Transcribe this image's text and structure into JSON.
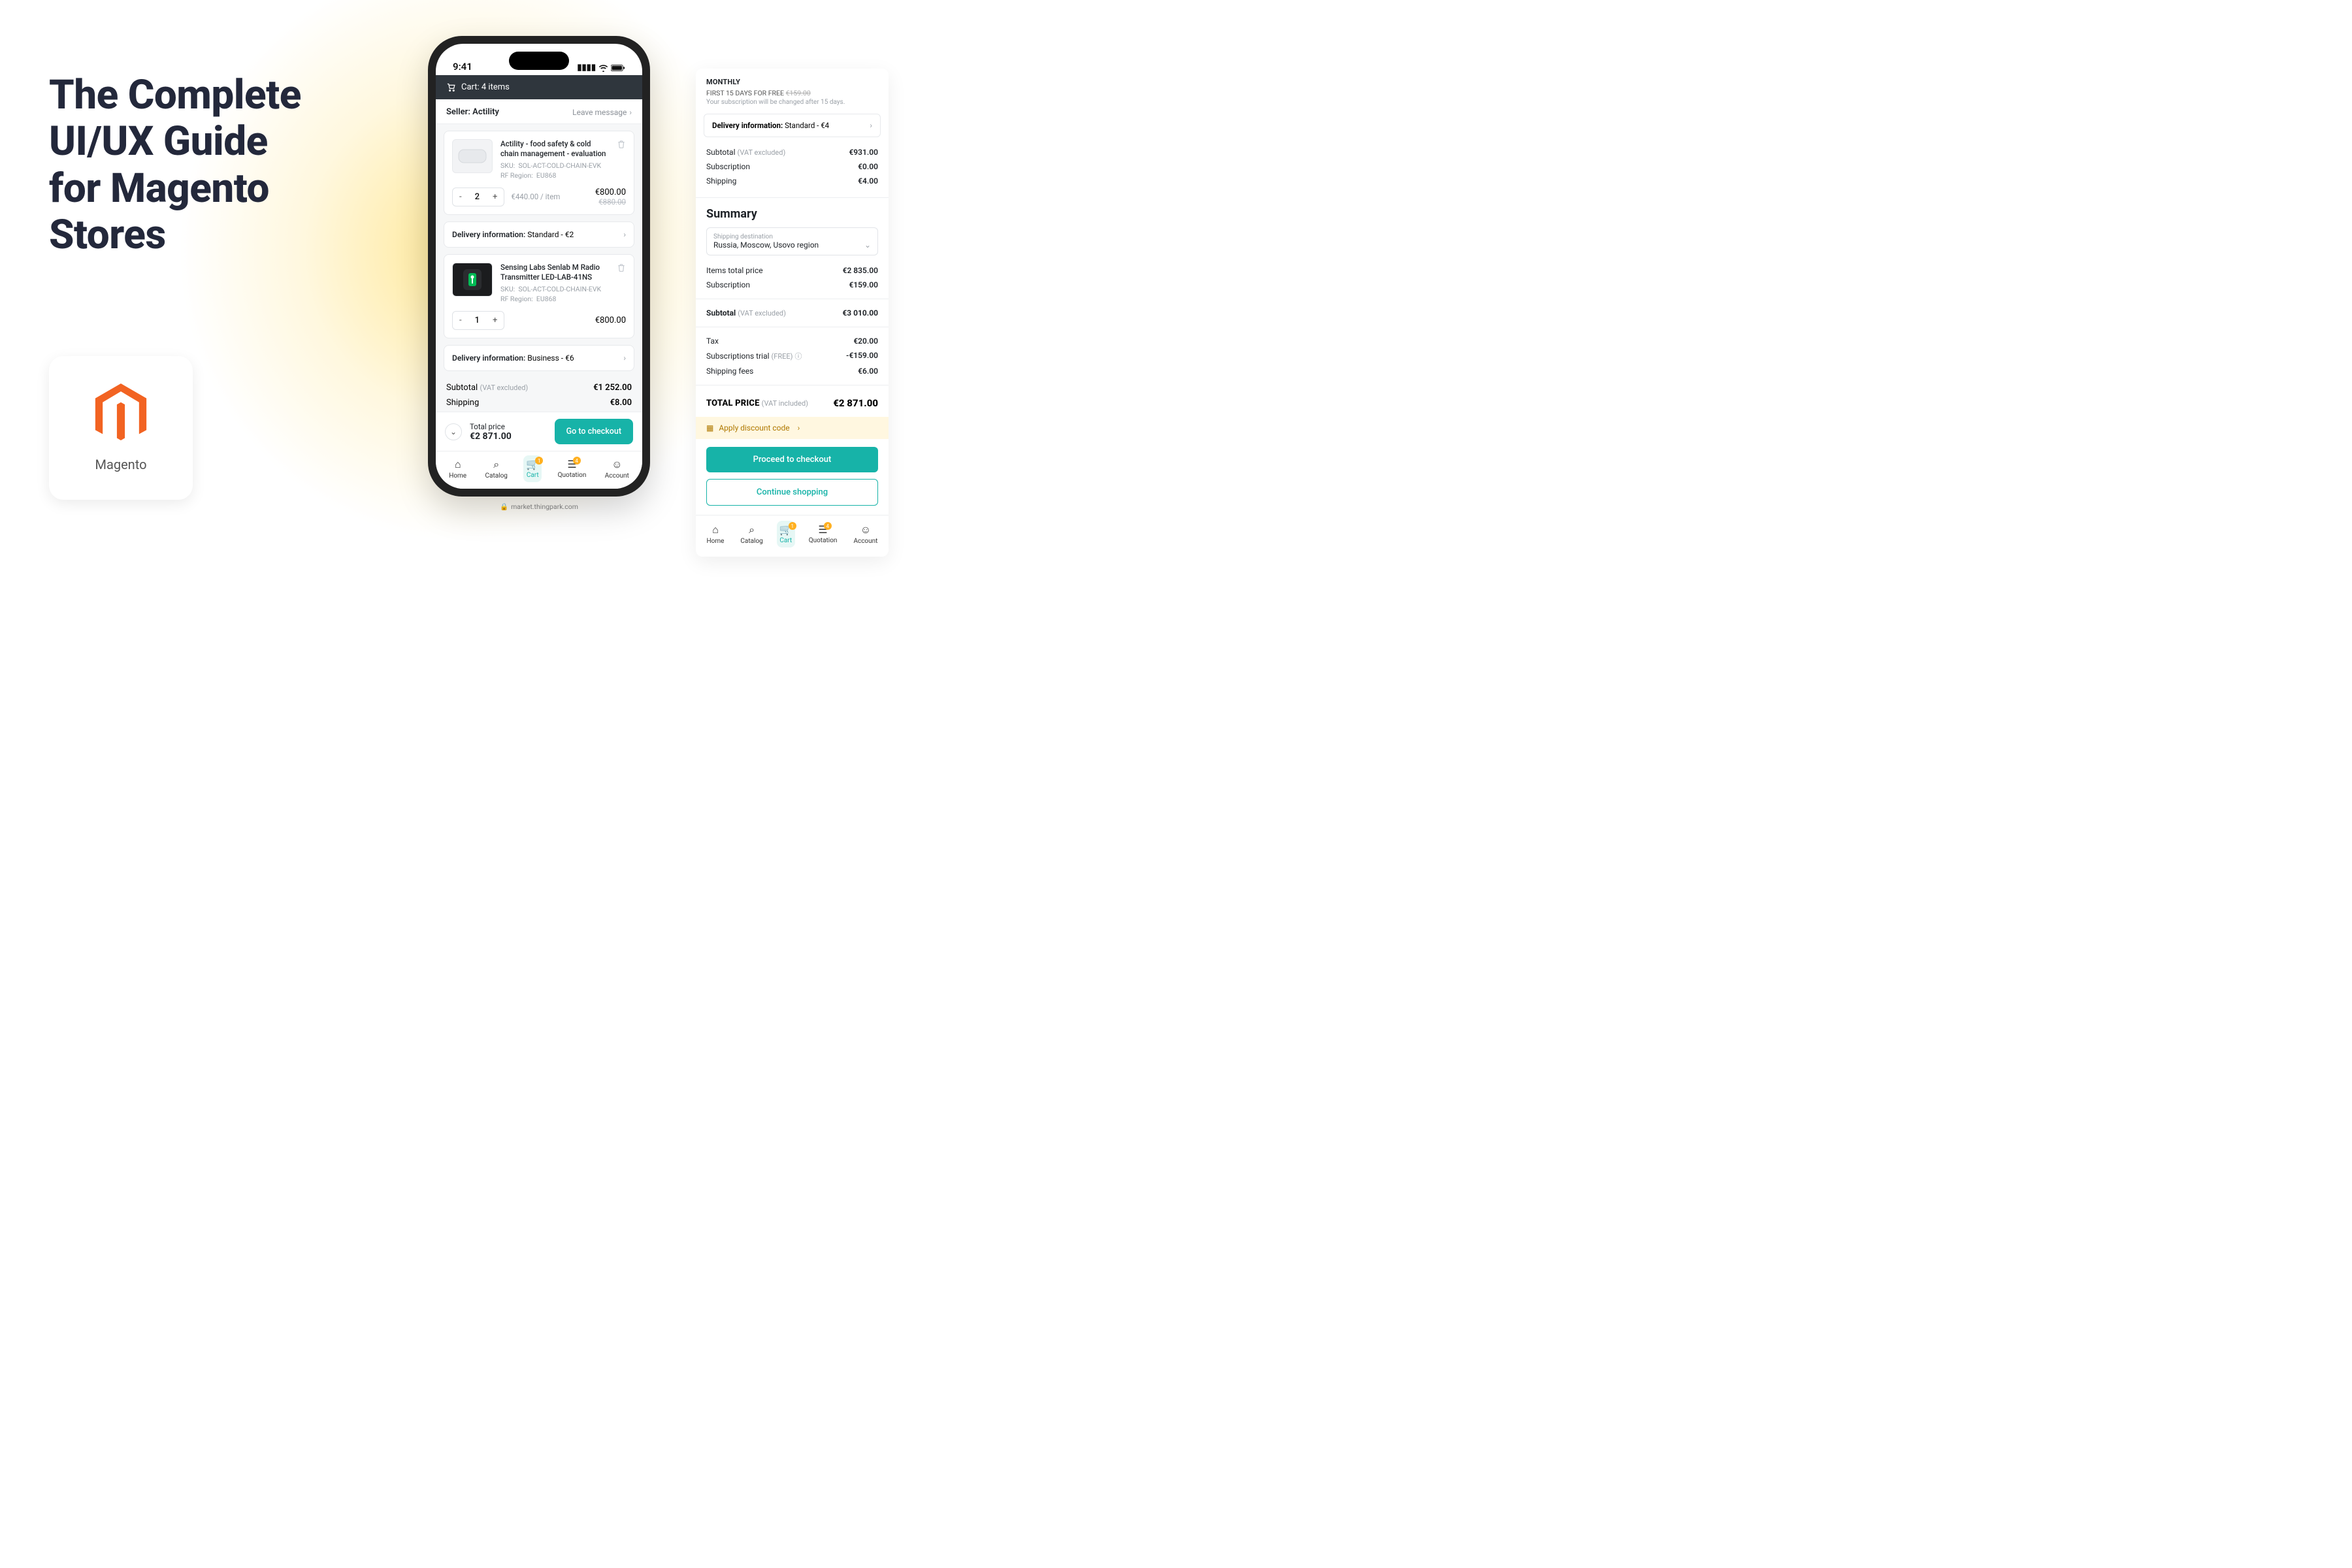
{
  "headline": {
    "l1": "The Complete",
    "l2": "UI/UX Guide",
    "l3": "for Magento",
    "l4": "Stores"
  },
  "logo": {
    "label": "Magento"
  },
  "phone": {
    "status_time": "9:41",
    "cart_header": "Cart: 4 items",
    "seller_label": "Seller:",
    "seller_name": "Actility",
    "leave_message": "Leave message",
    "items": [
      {
        "title": "Actility - food safety & cold chain management - evaluation",
        "sku_label": "SKU:",
        "sku": "SOL-ACT-COLD-CHAIN-EVK",
        "rf_label": "RF Region:",
        "rf": "EU868",
        "qty": "2",
        "per_item": "€440.00 / item",
        "price": "€800.00",
        "old_price": "€880.00",
        "delivery_label": "Delivery information:",
        "delivery_value": "Standard - €2"
      },
      {
        "title": "Sensing Labs Senlab M Radio Transmitter LED-LAB-41NS",
        "sku_label": "SKU:",
        "sku": "SOL-ACT-COLD-CHAIN-EVK",
        "rf_label": "RF Region:",
        "rf": "EU868",
        "qty": "1",
        "price": "€800.00",
        "delivery_label": "Delivery information:",
        "delivery_value": "Business - €6"
      }
    ],
    "subtotal_label": "Subtotal",
    "vat_excluded": "(VAT excluded)",
    "subtotal_value": "€1 252.00",
    "shipping_label": "Shipping",
    "shipping_value": "€8.00",
    "total_label": "Total price",
    "total_value": "€2 871.00",
    "checkout_btn": "Go to checkout",
    "tabs": {
      "home": "Home",
      "catalog": "Catalog",
      "cart": "Cart",
      "cart_badge": "1",
      "quotation": "Quotation",
      "quotation_badge": "4",
      "account": "Account"
    },
    "url": "market.thingpark.com"
  },
  "summary": {
    "monthly": "MONTHLY",
    "free_line": "FIRST 15 DAYS FOR FREE",
    "free_strike": "€159.00",
    "sub_note": "Your subscription will be changed  after 15 days.",
    "delivery_label": "Delivery information:",
    "delivery_value": "Standard - €4",
    "rows1": [
      {
        "label": "Subtotal",
        "sub": "(VAT excluded)",
        "value": "€931.00"
      },
      {
        "label": "Subscription",
        "value": "€0.00"
      },
      {
        "label": "Shipping",
        "value": "€4.00"
      }
    ],
    "title": "Summary",
    "dest_label": "Shipping destination",
    "dest_value": "Russia, Moscow, Usovo region",
    "rows2": [
      {
        "label": "Items total price",
        "value": "€2 835.00"
      },
      {
        "label": "Subscription",
        "value": "€159.00"
      }
    ],
    "subtotal_label": "Subtotal",
    "subtotal_sub": "(VAT excluded)",
    "subtotal_value": "€3 010.00",
    "rows3": [
      {
        "label": "Tax",
        "value": "€20.00"
      },
      {
        "label": "Subscriptions trial",
        "sub": "(FREE)",
        "info": true,
        "value": "-€159.00"
      },
      {
        "label": "Shipping fees",
        "value": "€6.00"
      }
    ],
    "total_label": "TOTAL PRICE",
    "total_sub": "(VAT included)",
    "total_value": "€2 871.00",
    "discount": "Apply discount code",
    "proceed": "Proceed to checkout",
    "continue": "Continue shopping"
  }
}
